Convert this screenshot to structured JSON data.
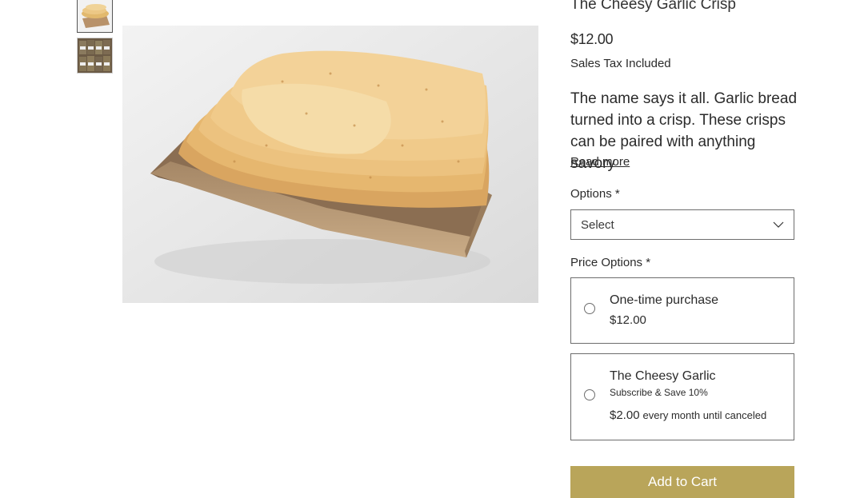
{
  "gallery": {
    "thumbnails": [
      "thumbnail-crisps",
      "thumbnail-packaged-bags"
    ],
    "active_index": 0
  },
  "product": {
    "title": "The Cheesy Garlic Crisp",
    "price": "$12.00",
    "tax_note": "Sales Tax Included",
    "description": "The name says it all. Garlic bread turned into a crisp. These crisps can be paired with anything savory",
    "read_more": "Read more"
  },
  "options": {
    "label": "Options *",
    "selected": "Select"
  },
  "price_options": {
    "label": "Price Options *",
    "one_time": {
      "name": "One-time purchase",
      "price": "$12.00"
    },
    "subscription": {
      "name": "The Cheesy Garlic",
      "subtitle": "Subscribe & Save 10%",
      "price": "$2.00",
      "frequency": "every month until canceled"
    }
  },
  "cart": {
    "button_label": "Add to Cart",
    "button_color": "#b9a55a"
  }
}
